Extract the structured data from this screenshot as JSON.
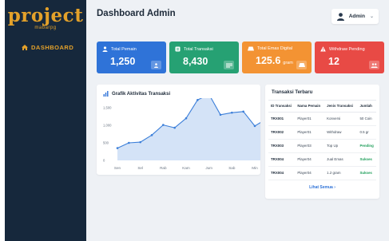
{
  "app": {
    "logo_main": "project",
    "logo_sub": "mabarpg"
  },
  "sidebar": {
    "items": [
      {
        "label": "DASHBOARD",
        "icon": "home-icon",
        "active": true
      }
    ]
  },
  "header": {
    "title": "Dashboard Admin",
    "user_label": "Admin"
  },
  "stats": [
    {
      "label": "Total Pemain",
      "value": "1,250",
      "unit": "",
      "color": "#2f73d8",
      "icon": "user-icon"
    },
    {
      "label": "Total Transaksi",
      "value": "8,430",
      "unit": "",
      "color": "#26a173",
      "icon": "receipt-icon"
    },
    {
      "label": "Total Emas Digital",
      "value": "125.6",
      "unit": "gram",
      "color": "#f39333",
      "icon": "gold-icon"
    },
    {
      "label": "Withdraw Pending",
      "value": "12",
      "unit": "",
      "color": "#e84a45",
      "icon": "warning-icon"
    }
  ],
  "chart_panel": {
    "title": "Grafik Aktivitas Transaksi"
  },
  "chart_data": {
    "type": "area",
    "categories": [
      "Sen",
      "Sel",
      "Rab",
      "Kam",
      "Jum",
      "Sab",
      "Min"
    ],
    "y_ticks": [
      "1,500",
      "1,000",
      "500",
      "0"
    ],
    "ylim": [
      0,
      1500
    ],
    "x": [
      0,
      0.5,
      1,
      1.5,
      2,
      2.5,
      3,
      3.5,
      4,
      4.5,
      5,
      5.5,
      6,
      6.5
    ],
    "values": [
      350,
      500,
      520,
      720,
      1010,
      930,
      1200,
      1720,
      1880,
      1300,
      1360,
      1390,
      980,
      1180
    ],
    "xlabel": "",
    "ylabel": "",
    "grid": false,
    "color": "#3c7fd9"
  },
  "transactions": {
    "title": "Transaksi Terbaru",
    "columns": [
      "ID Transaksi",
      "Nama Pemain",
      "Jenis Transaksi",
      "Jumlah"
    ],
    "rows": [
      {
        "id": "TRX001",
        "player": "Player01",
        "type": "Konversi",
        "amount": "50 Coin",
        "status": false
      },
      {
        "id": "TRX002",
        "player": "Player01",
        "type": "Withdraw",
        "amount": "0.5 gr",
        "status": false
      },
      {
        "id": "TRX003",
        "player": "Player03",
        "type": "Top Up",
        "amount": "Pending",
        "status": true
      },
      {
        "id": "TRX004",
        "player": "Player04",
        "type": "Jual Emas",
        "amount": "Sukses",
        "status": true
      },
      {
        "id": "TRX004",
        "player": "Player04",
        "type": "1.2 gram",
        "amount": "Sukses",
        "status": true
      }
    ],
    "see_all": "Lihat Semua"
  }
}
